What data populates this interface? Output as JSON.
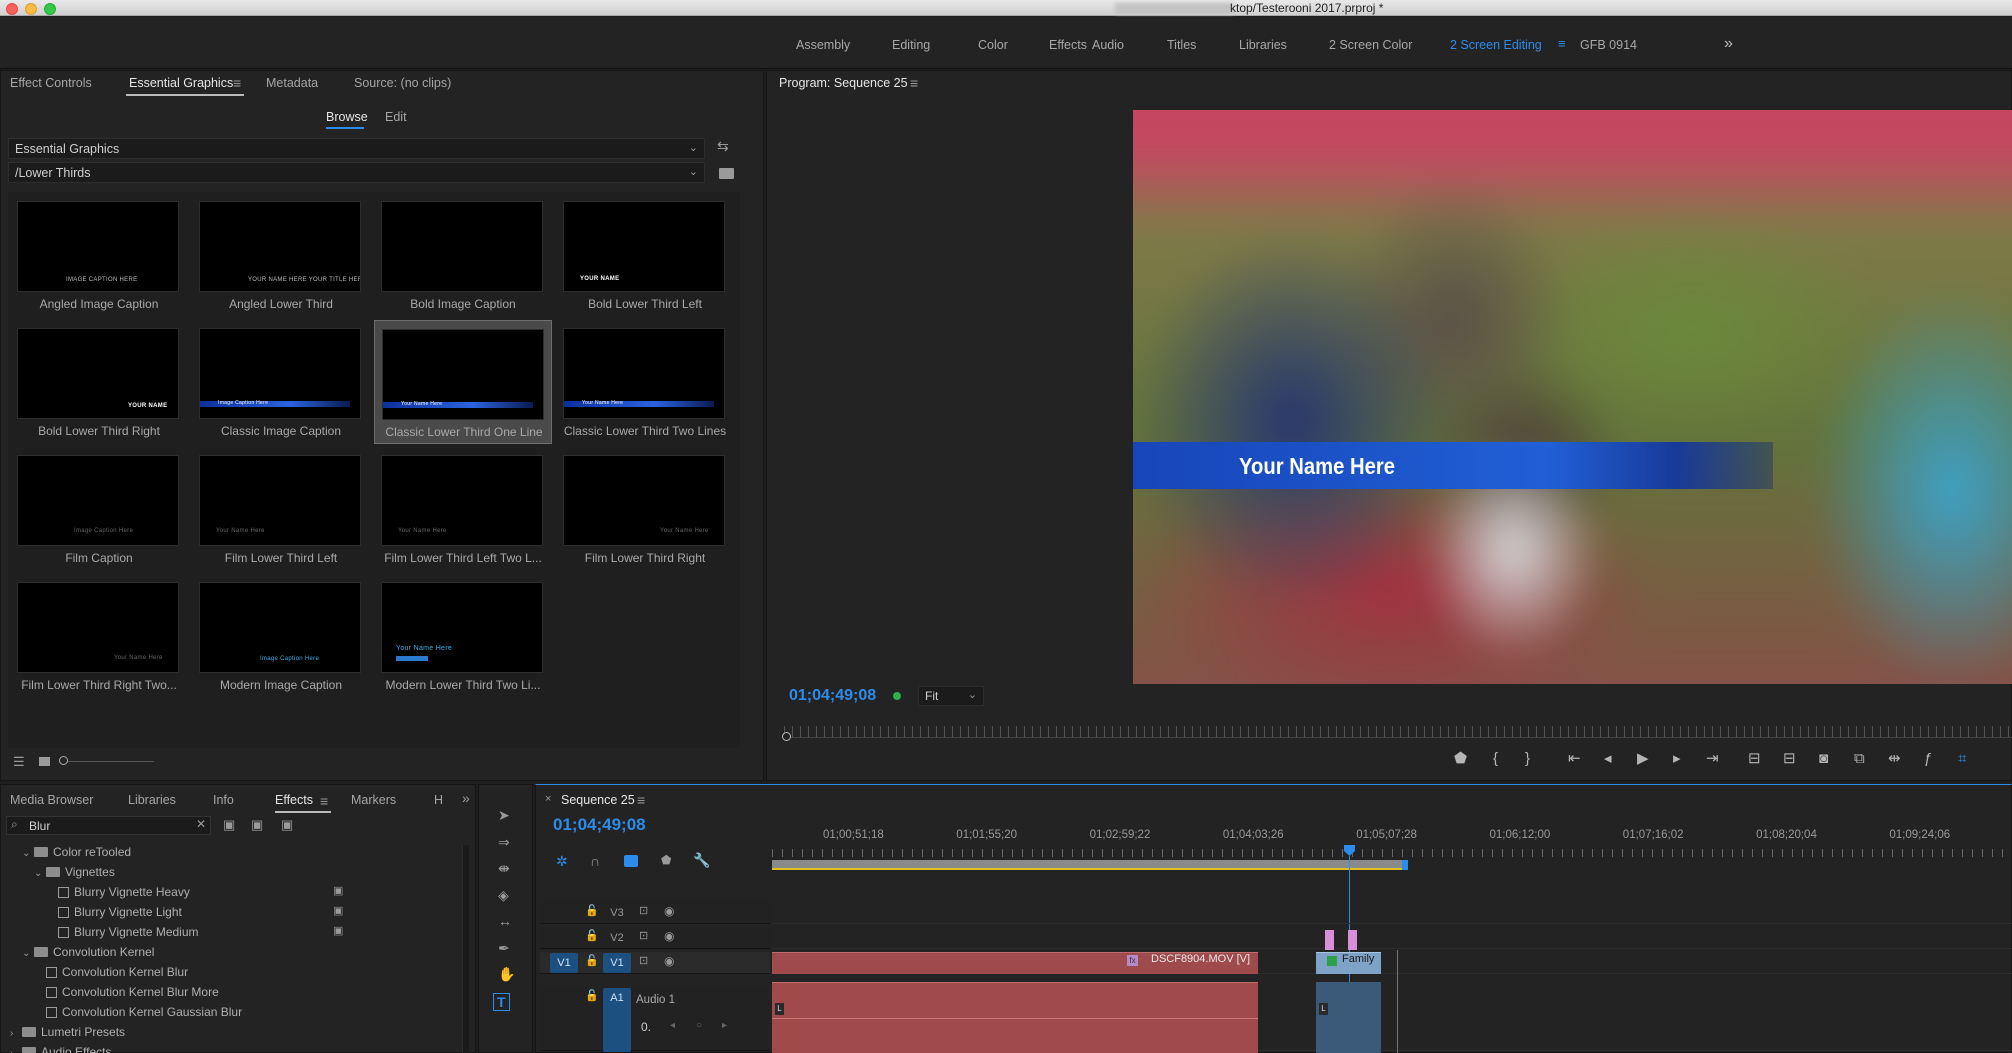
{
  "window": {
    "title": "ktop/Testerooni 2017.prproj *"
  },
  "workspaces": {
    "tabs": [
      "Assembly",
      "Editing",
      "Color",
      "Effects",
      "Audio",
      "Titles",
      "Libraries",
      "2 Screen Color",
      "2 Screen Editing",
      "GFB 0914"
    ],
    "active": "2 Screen Editing",
    "overflow_icon": "double-chevron-right"
  },
  "essential_graphics_panel": {
    "tabs": [
      "Effect Controls",
      "Essential Graphics",
      "Metadata",
      "Source: (no clips)"
    ],
    "active_tab": "Essential Graphics",
    "subtabs": [
      "Browse",
      "Edit"
    ],
    "active_subtab": "Browse",
    "library_dropdown": "Essential Graphics",
    "folder_dropdown": "/Lower Thirds",
    "templates": [
      {
        "label": "Angled Image Caption",
        "preview_text": "IMAGE CAPTION HERE",
        "style": "center-text"
      },
      {
        "label": "Angled Lower Third",
        "preview_text": "YOUR NAME HERE  YOUR TITLE HERE",
        "style": "center-text"
      },
      {
        "label": "Bold Image Caption",
        "preview_text": "",
        "style": "empty"
      },
      {
        "label": "Bold Lower Third Left",
        "preview_text": "YOUR NAME",
        "style": "left-box"
      },
      {
        "label": "Bold Lower Third Right",
        "preview_text": "YOUR NAME",
        "style": "right-box"
      },
      {
        "label": "Classic Image Caption",
        "preview_text": "Image Caption Here",
        "style": "blue-bar"
      },
      {
        "label": "Classic Lower Third One Line",
        "preview_text": "Your Name Here",
        "style": "blue-bar",
        "selected": true
      },
      {
        "label": "Classic Lower Third Two Lines",
        "preview_text": "Your Name Here",
        "style": "blue-bar"
      },
      {
        "label": "Film Caption",
        "preview_text": "Image Caption Here",
        "style": "faint-center"
      },
      {
        "label": "Film Lower Third Left",
        "preview_text": "Your Name Here",
        "style": "faint-left"
      },
      {
        "label": "Film Lower Third Left Two L...",
        "preview_text": "Your Name Here",
        "style": "faint-left"
      },
      {
        "label": "Film Lower Third Right",
        "preview_text": "Your Name Here",
        "style": "faint-right"
      },
      {
        "label": "Film Lower Third Right Two...",
        "preview_text": "Your Name Here",
        "style": "faint-right"
      },
      {
        "label": "Modern Image Caption",
        "preview_text": "Image Caption Here",
        "style": "cyan-center"
      },
      {
        "label": "Modern Lower Third Two Li...",
        "preview_text": "Your Name Here",
        "style": "modern"
      }
    ]
  },
  "program_monitor": {
    "title": "Program: Sequence 25",
    "overlay_text": "Your Name Here",
    "timecode": "01;04;49;08",
    "fit": "Fit",
    "transport_icons": [
      "marker",
      "in-point",
      "out-point",
      "go-to-in",
      "step-back",
      "play",
      "step-forward",
      "go-to-out",
      "lift",
      "extract",
      "export-frame",
      "comparison-view",
      "trim",
      "fx",
      "vr"
    ]
  },
  "effects_panel": {
    "tabs": [
      "Media Browser",
      "Libraries",
      "Info",
      "Effects",
      "Markers",
      "H"
    ],
    "active_tab": "Effects",
    "search_value": "Blur",
    "tree": [
      {
        "label": "Color reTooled",
        "type": "folder",
        "level": 1,
        "expanded": true
      },
      {
        "label": "Vignettes",
        "type": "folder",
        "level": 2,
        "expanded": true
      },
      {
        "label": "Blurry Vignette Heavy",
        "type": "preset",
        "level": 3,
        "badge": true
      },
      {
        "label": "Blurry Vignette Light",
        "type": "preset",
        "level": 3,
        "badge": true
      },
      {
        "label": "Blurry Vignette Medium",
        "type": "preset",
        "level": 3,
        "badge": true
      },
      {
        "label": "Convolution Kernel",
        "type": "folder",
        "level": 1,
        "expanded": true
      },
      {
        "label": "Convolution Kernel Blur",
        "type": "preset",
        "level": 2,
        "badge": false
      },
      {
        "label": "Convolution Kernel Blur More",
        "type": "preset",
        "level": 2,
        "badge": false
      },
      {
        "label": "Convolution Kernel Gaussian Blur",
        "type": "preset",
        "level": 2,
        "badge": false
      },
      {
        "label": "Lumetri Presets",
        "type": "folder",
        "level": 0,
        "expanded": false
      },
      {
        "label": "Audio Effects",
        "type": "folder",
        "level": 0,
        "expanded": false
      }
    ]
  },
  "tools": [
    "selection-tool",
    "track-select-tool",
    "ripple-edit-tool",
    "razor-tool",
    "slip-tool",
    "pen-tool",
    "hand-tool",
    "type-tool"
  ],
  "timeline": {
    "title": "Sequence 25",
    "timecode": "01;04;49;08",
    "ruler_labels": [
      "01;00;51;18",
      "01;01;55;20",
      "01;02;59;22",
      "01;04;03;26",
      "01;05;07;28",
      "01;06;12;00",
      "01;07;16;02",
      "01;08;20;04",
      "01;09;24;06"
    ],
    "tracks": [
      {
        "name": "V3",
        "patch": ""
      },
      {
        "name": "V2",
        "patch": ""
      },
      {
        "name": "V1",
        "patch": "V1"
      },
      {
        "name": "A1",
        "patch": "",
        "label": "Audio 1",
        "volume": "0."
      }
    ],
    "clips": [
      {
        "track": "V1",
        "label": "DSCF8904.MOV [V]"
      },
      {
        "track": "V1",
        "label": "Family"
      }
    ],
    "audio_clip_marker": "L"
  }
}
